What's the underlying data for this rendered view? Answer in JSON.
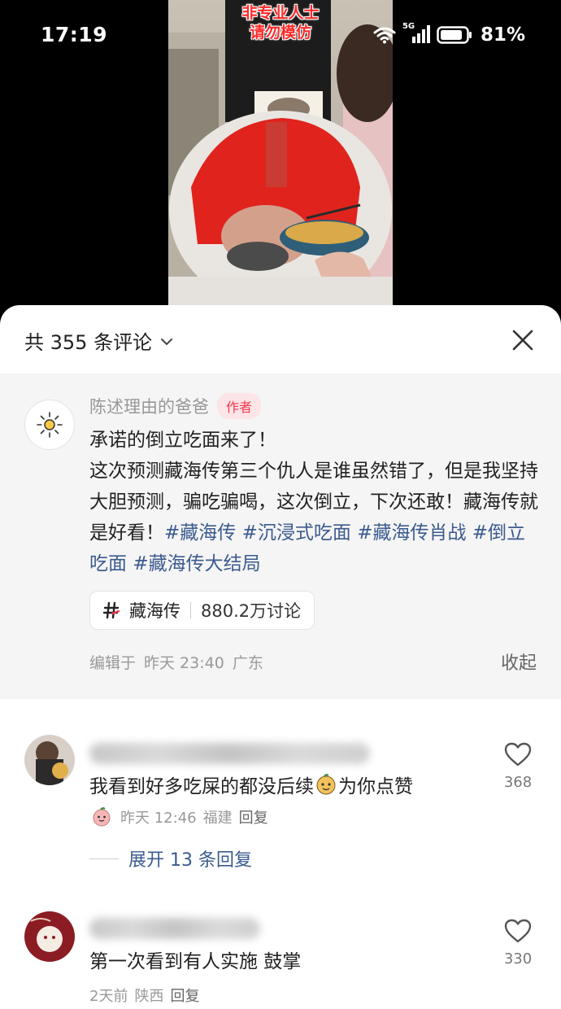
{
  "status_bar": {
    "time": "17:19",
    "network": "5G",
    "battery": "81%",
    "icons": [
      "wifi-icon",
      "signal-icon",
      "battery-icon"
    ]
  },
  "video": {
    "overlay_text_line1": "非专业人士",
    "overlay_text_line2": "请勿模仿"
  },
  "comments_panel": {
    "count_label": "共 355 条评论",
    "author_post": {
      "author_name": "陈述理由的爸爸",
      "author_tag": "作者",
      "text": "承诺的倒立吃面来了！\n这次预测藏海传第三个仇人是谁虽然错了，但是我坚持大胆预测，骗吃骗喝，这次倒立，下次还敢！藏海传就是好看！",
      "hashtags": [
        "#藏海传",
        "#沉浸式吃面",
        "#藏海传肖战",
        "#倒立吃面",
        "#藏海传大结局"
      ],
      "topic": {
        "name": "藏海传",
        "discussions": "880.2万讨论"
      },
      "edited_label": "编辑于",
      "time": "昨天 23:40",
      "location": "广东",
      "collapse_label": "收起"
    },
    "comments": [
      {
        "text": "我看到好多吃屎的都没后续",
        "text_suffix": "为你点赞",
        "time": "昨天 12:46",
        "location": "福建",
        "reply_label": "回复",
        "likes": "368",
        "expand_label": "展开 13 条回复"
      },
      {
        "text": "第一次看到有人实施  鼓掌",
        "time": "2天前",
        "location": "陕西",
        "reply_label": "回复",
        "likes": "330"
      }
    ]
  },
  "colors": {
    "accent_link": "#3b5b8f",
    "author_tag": "#f0394b",
    "author_post_bg": "#f5f5f5"
  }
}
